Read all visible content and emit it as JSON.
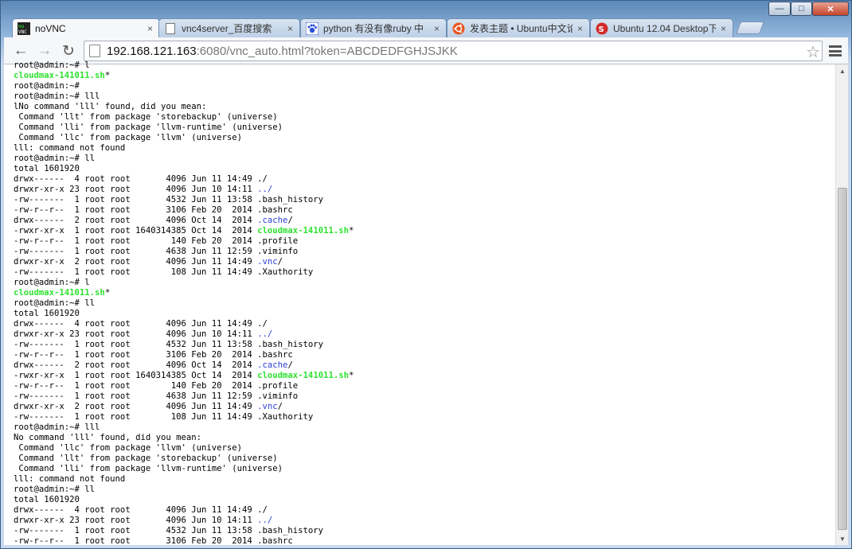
{
  "browser": {
    "window_controls": {
      "minimize": "—",
      "maximize": "□",
      "close": "✕"
    },
    "tabs": [
      {
        "label": "noVNC",
        "icon": "novnc-icon",
        "close": "×",
        "active": true
      },
      {
        "label": "vnc4server_百度搜索",
        "icon": "page-icon",
        "close": "×",
        "active": false
      },
      {
        "label": "python 有没有像ruby 中",
        "icon": "baidu-paw-icon",
        "close": "×",
        "active": false
      },
      {
        "label": "发表主题 • Ubuntu中文论",
        "icon": "ubuntu-icon",
        "close": "×",
        "active": false
      },
      {
        "label": "Ubuntu 12.04 Desktop下",
        "icon": "search-result-icon",
        "close": "×",
        "active": false
      }
    ],
    "address": {
      "host": "192.168.121.163",
      "rest": ":6080/vnc_auto.html?token=ABCDEDFGHJSJKK"
    },
    "nav": {
      "back": "←",
      "forward": "→",
      "reload": "↻",
      "bookmark": "☆"
    }
  },
  "colors": {
    "exec_file": "#2ee22e",
    "directory": "#2d3fd7"
  },
  "terminal": {
    "lines": [
      [
        {
          "t": "root@admin:~# l"
        }
      ],
      [
        {
          "t": "cloudmax-141011.sh",
          "c": "exe"
        },
        {
          "t": "*"
        }
      ],
      [
        {
          "t": "root@admin:~#"
        }
      ],
      [
        {
          "t": "root@admin:~# lll"
        }
      ],
      [
        {
          "t": "lNo command 'lll' found, did you mean:"
        }
      ],
      [
        {
          "t": " Command 'llt' from package 'storebackup' (universe)"
        }
      ],
      [
        {
          "t": " Command 'lli' from package 'llvm-runtime' (universe)"
        }
      ],
      [
        {
          "t": " Command 'llc' from package 'llvm' (universe)"
        }
      ],
      [
        {
          "t": "lll: command not found"
        }
      ],
      [
        {
          "t": "root@admin:~# ll"
        }
      ],
      [
        {
          "t": "total 1601920"
        }
      ],
      [
        {
          "t": "drwx------  4 root root       4096 Jun 11 14:49 ./"
        }
      ],
      [
        {
          "t": "drwxr-xr-x 23 root root       4096 Jun 10 14:11 "
        },
        {
          "t": "../",
          "c": "dir"
        }
      ],
      [
        {
          "t": "-rw-------  1 root root       4532 Jun 11 13:58 .bash_history"
        }
      ],
      [
        {
          "t": "-rw-r--r--  1 root root       3106 Feb 20  2014 .bashrc"
        }
      ],
      [
        {
          "t": "drwx------  2 root root       4096 Oct 14  2014 "
        },
        {
          "t": ".cache",
          "c": "dir"
        },
        {
          "t": "/"
        }
      ],
      [
        {
          "t": "-rwxr-xr-x  1 root root 1640314385 Oct 14  2014 "
        },
        {
          "t": "cloudmax-141011.sh",
          "c": "exe"
        },
        {
          "t": "*"
        }
      ],
      [
        {
          "t": "-rw-r--r--  1 root root        140 Feb 20  2014 .profile"
        }
      ],
      [
        {
          "t": "-rw-------  1 root root       4638 Jun 11 12:59 .viminfo"
        }
      ],
      [
        {
          "t": "drwxr-xr-x  2 root root       4096 Jun 11 14:49 "
        },
        {
          "t": ".vnc",
          "c": "dir"
        },
        {
          "t": "/"
        }
      ],
      [
        {
          "t": "-rw-------  1 root root        108 Jun 11 14:49 .Xauthority"
        }
      ],
      [
        {
          "t": "root@admin:~# l"
        }
      ],
      [
        {
          "t": "cloudmax-141011.sh",
          "c": "exe"
        },
        {
          "t": "*"
        }
      ],
      [
        {
          "t": "root@admin:~# ll"
        }
      ],
      [
        {
          "t": "total 1601920"
        }
      ],
      [
        {
          "t": "drwx------  4 root root       4096 Jun 11 14:49 ./"
        }
      ],
      [
        {
          "t": "drwxr-xr-x 23 root root       4096 Jun 10 14:11 "
        },
        {
          "t": "../",
          "c": "dir"
        }
      ],
      [
        {
          "t": "-rw-------  1 root root       4532 Jun 11 13:58 .bash_history"
        }
      ],
      [
        {
          "t": "-rw-r--r--  1 root root       3106 Feb 20  2014 .bashrc"
        }
      ],
      [
        {
          "t": "drwx------  2 root root       4096 Oct 14  2014 "
        },
        {
          "t": ".cache",
          "c": "dir"
        },
        {
          "t": "/"
        }
      ],
      [
        {
          "t": "-rwxr-xr-x  1 root root 1640314385 Oct 14  2014 "
        },
        {
          "t": "cloudmax-141011.sh",
          "c": "exe"
        },
        {
          "t": "*"
        }
      ],
      [
        {
          "t": "-rw-r--r--  1 root root        140 Feb 20  2014 .profile"
        }
      ],
      [
        {
          "t": "-rw-------  1 root root       4638 Jun 11 12:59 .viminfo"
        }
      ],
      [
        {
          "t": "drwxr-xr-x  2 root root       4096 Jun 11 14:49 "
        },
        {
          "t": ".vnc",
          "c": "dir"
        },
        {
          "t": "/"
        }
      ],
      [
        {
          "t": "-rw-------  1 root root        108 Jun 11 14:49 .Xauthority"
        }
      ],
      [
        {
          "t": "root@admin:~# lll"
        }
      ],
      [
        {
          "t": "No command 'lll' found, did you mean:"
        }
      ],
      [
        {
          "t": " Command 'llc' from package 'llvm' (universe)"
        }
      ],
      [
        {
          "t": " Command 'llt' from package 'storebackup' (universe)"
        }
      ],
      [
        {
          "t": " Command 'lli' from package 'llvm-runtime' (universe)"
        }
      ],
      [
        {
          "t": "lll: command not found"
        }
      ],
      [
        {
          "t": "root@admin:~# ll"
        }
      ],
      [
        {
          "t": "total 1601920"
        }
      ],
      [
        {
          "t": "drwx------  4 root root       4096 Jun 11 14:49 ./"
        }
      ],
      [
        {
          "t": "drwxr-xr-x 23 root root       4096 Jun 10 14:11 "
        },
        {
          "t": "../",
          "c": "dir"
        }
      ],
      [
        {
          "t": "-rw-------  1 root root       4532 Jun 11 13:58 .bash_history"
        }
      ],
      [
        {
          "t": "-rw-r--r--  1 root root       3106 Feb 20  2014 .bashrc"
        }
      ]
    ]
  }
}
